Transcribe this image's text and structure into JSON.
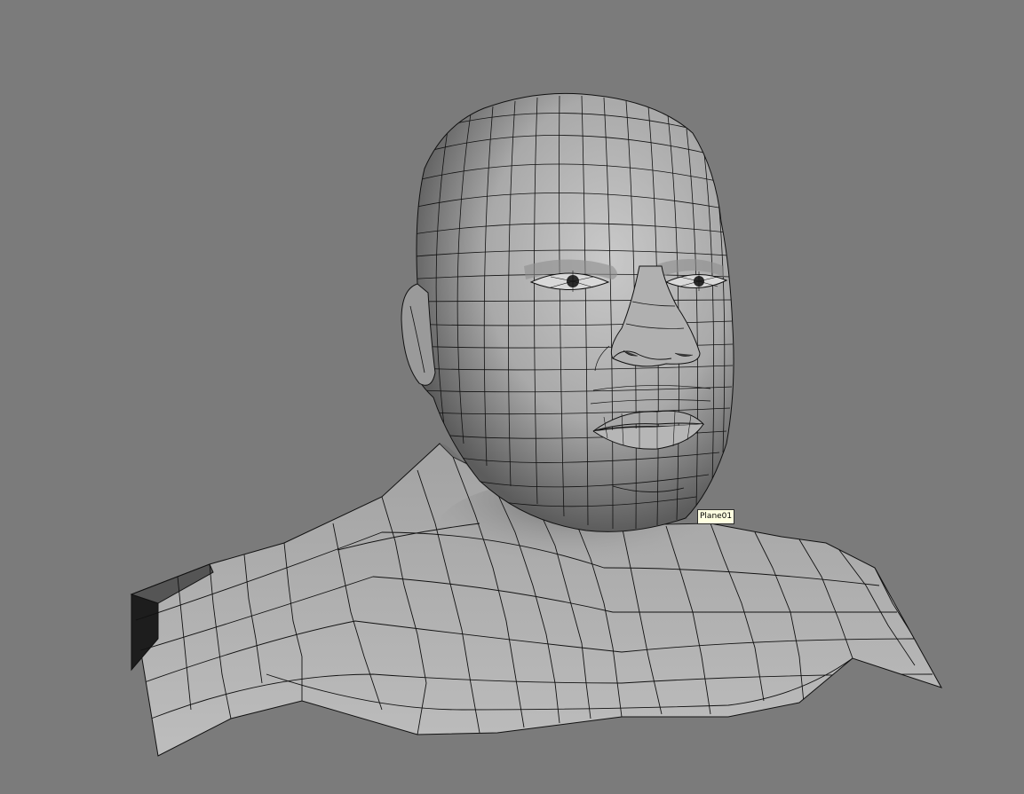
{
  "viewport": {
    "background_color": "#7b7b7b",
    "content": "wireframe-head-bust-mesh",
    "mesh_shade_color": "#b4b4b4",
    "wire_color": "#111111"
  },
  "tooltip": {
    "label": "Plane01",
    "background_color": "#ffffe1"
  }
}
